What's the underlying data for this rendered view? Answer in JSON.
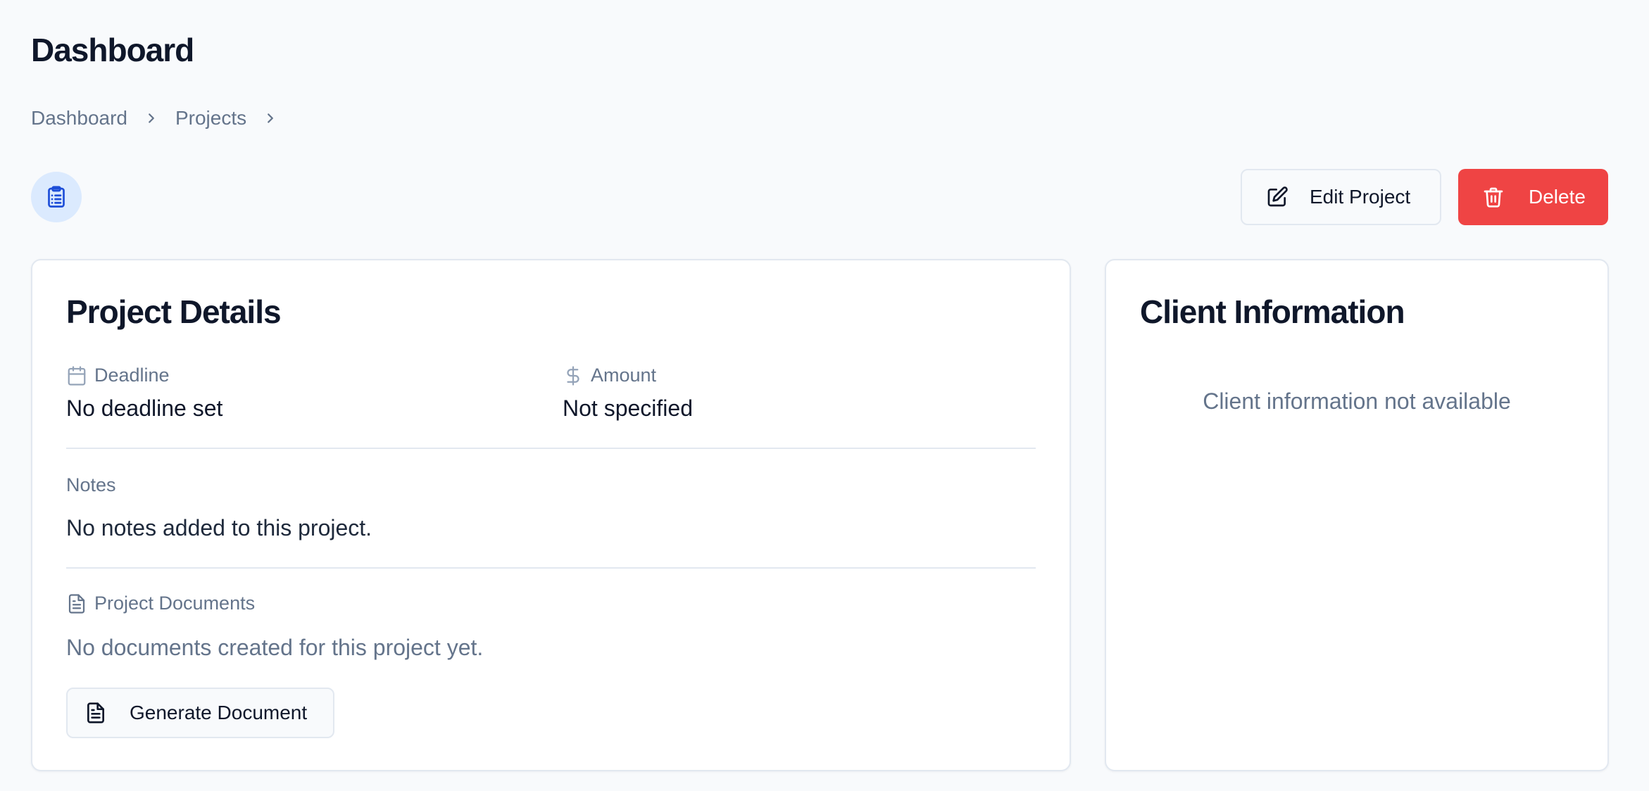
{
  "page": {
    "title": "Dashboard"
  },
  "breadcrumb": {
    "items": [
      "Dashboard",
      "Projects"
    ]
  },
  "header": {
    "project_icon": "clipboard-list-icon",
    "edit_button": {
      "label": "Edit Project",
      "icon": "edit-icon"
    },
    "delete_button": {
      "label": "Delete",
      "icon": "trash-icon"
    }
  },
  "project_details": {
    "title": "Project Details",
    "deadline": {
      "label": "Deadline",
      "icon": "calendar-icon",
      "value": "No deadline set"
    },
    "amount": {
      "label": "Amount",
      "icon": "dollar-icon",
      "value": "Not specified"
    },
    "notes": {
      "label": "Notes",
      "value": "No notes added to this project."
    },
    "documents": {
      "label": "Project Documents",
      "icon": "file-text-icon",
      "empty_text": "No documents created for this project yet.",
      "generate_button": {
        "label": "Generate Document",
        "icon": "file-text-icon"
      }
    }
  },
  "client_information": {
    "title": "Client Information",
    "empty_text": "Client information not available"
  },
  "colors": {
    "background": "#f8fafc",
    "card": "#ffffff",
    "border": "#e2e8f0",
    "text_primary": "#0f172a",
    "text_muted": "#64748b",
    "danger": "#ef4444",
    "icon_bg": "#dbeafe",
    "icon_accent": "#1d4ed8"
  }
}
